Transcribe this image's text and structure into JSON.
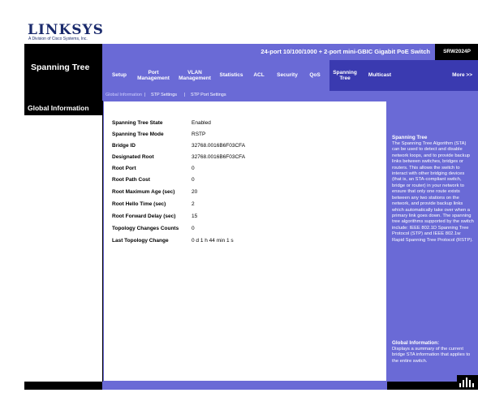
{
  "brand": {
    "logo": "LINKSYS",
    "tagline": "A Division of Cisco Systems, Inc."
  },
  "header": {
    "model_title": "24-port 10/100/1000 + 2-port mini-GBIC Gigabit PoE Switch",
    "model_badge": "SRW2024P",
    "section": "Spanning Tree"
  },
  "nav": {
    "items": [
      {
        "label": "Setup"
      },
      {
        "label": "Port Management"
      },
      {
        "label": "VLAN Management"
      },
      {
        "label": "Statistics"
      },
      {
        "label": "ACL"
      },
      {
        "label": "Security"
      },
      {
        "label": "QoS"
      },
      {
        "label": "Spanning Tree"
      },
      {
        "label": "Multicast"
      },
      {
        "label": "More >>"
      }
    ]
  },
  "subnav": {
    "items": [
      {
        "label": "Global Information"
      },
      {
        "label": "STP Settings"
      },
      {
        "label": "STP Port Settings"
      }
    ],
    "separator": "|"
  },
  "left": {
    "active_tab": "Global Information"
  },
  "fields": [
    {
      "label": "Spanning Tree State",
      "value": "Enabled"
    },
    {
      "label": "Spanning Tree Mode",
      "value": "RSTP"
    },
    {
      "label": "Bridge ID",
      "value": "32768.0016B6F03CFA"
    },
    {
      "label": "Designated Root",
      "value": "32768.0016B6F03CFA"
    },
    {
      "label": "Root Port",
      "value": "0"
    },
    {
      "label": "Root Path Cost",
      "value": "0"
    },
    {
      "label": "Root Maximum Age (sec)",
      "value": "20"
    },
    {
      "label": "Root Hello Time (sec)",
      "value": "2"
    },
    {
      "label": "Root Forward Delay (sec)",
      "value": "15"
    },
    {
      "label": "Topology Changes Counts",
      "value": "0"
    },
    {
      "label": "Last Topology Change",
      "value": "0 d 1 h 44 min 1 s"
    }
  ],
  "help": {
    "title1": "Spanning Tree",
    "body1": "The Spanning Tree Algorithm (STA) can be used to detect and disable network loops, and to provide backup links between switches, bridges or routers. This allows the switch to interact with other bridging devices (that is, an STA-compliant switch, bridge or router) in your network to ensure that only one route exists between any two stations on the network, and provide backup links which automatically take over when a primary link goes down. The spanning tree algorithms supported by the switch include: IEEE 802.1D Spanning Tree Protocol (STP) and IEEE 802.1w Rapid Spanning Tree Protocol (RSTP).",
    "title2": "Global Information:",
    "body2": "Displays a summary of the current bridge STA information that applies to the entire switch."
  }
}
